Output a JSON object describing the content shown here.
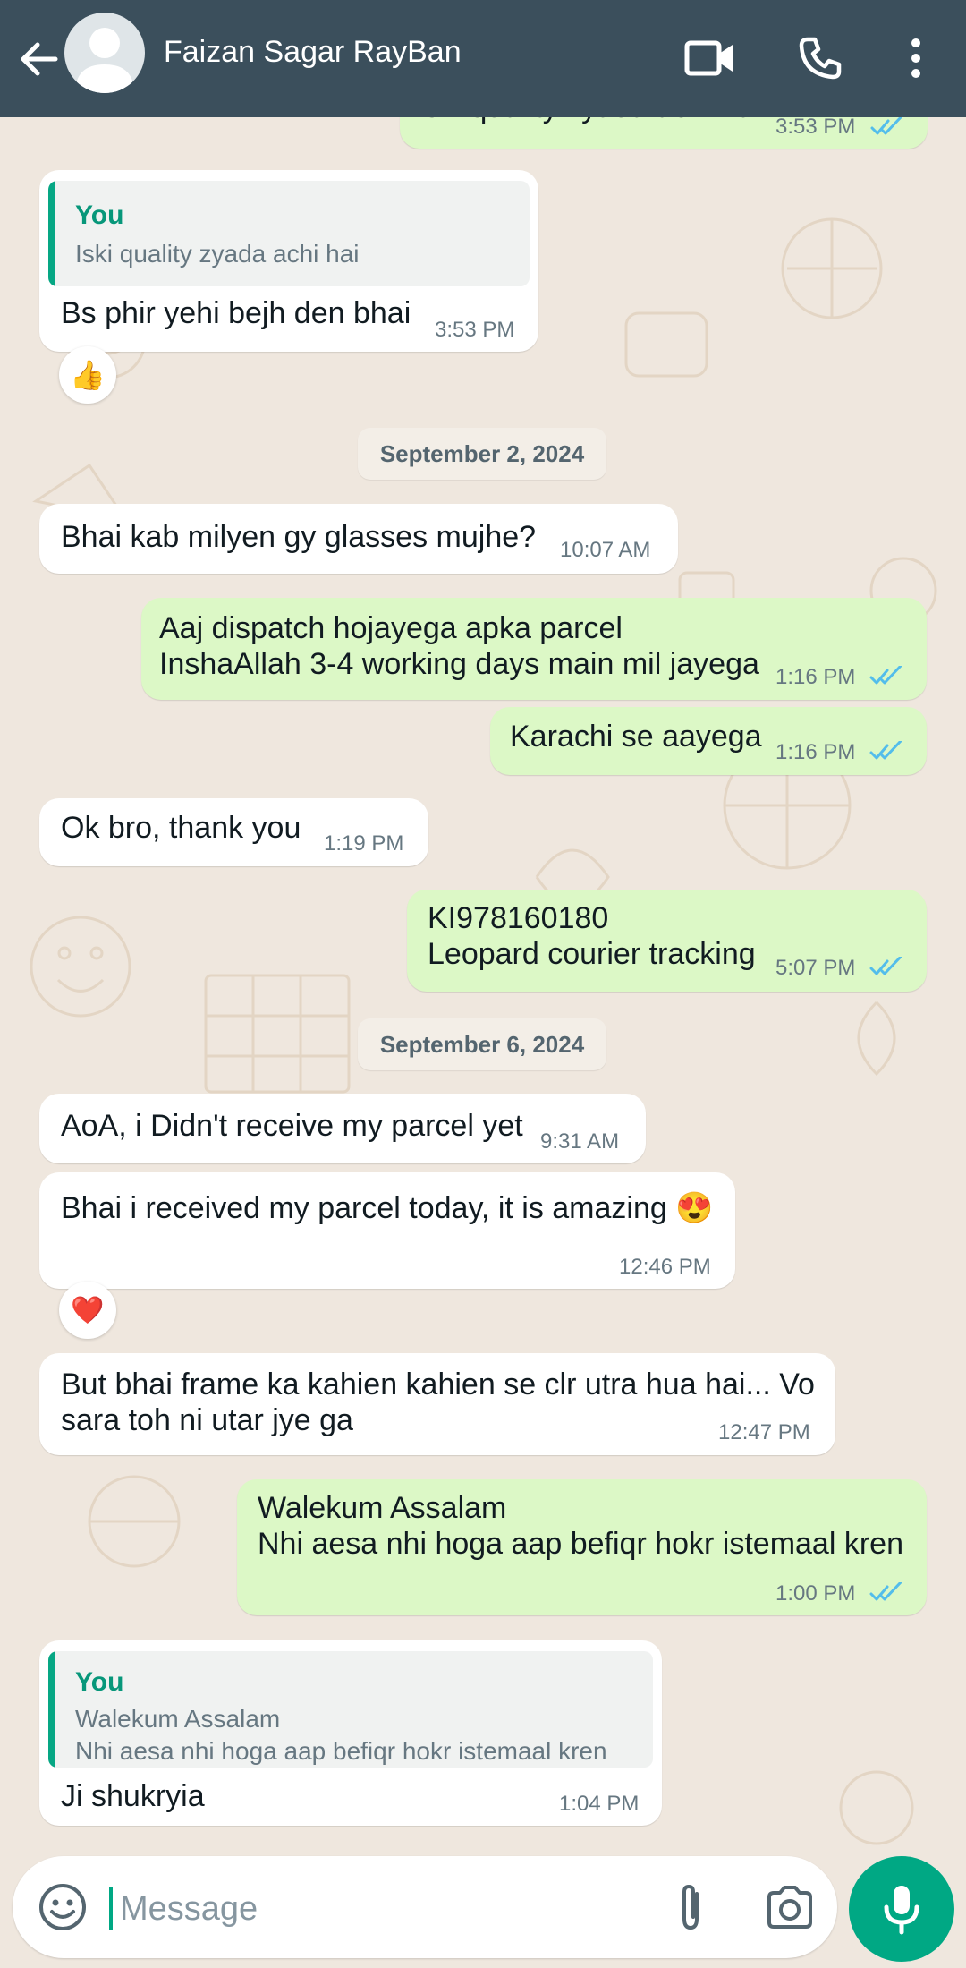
{
  "header": {
    "contact_name": "Faizan Sagar RayBan",
    "bg_color": "#3b4f5c",
    "icons": [
      "back-arrow-icon",
      "avatar",
      "video-call-icon",
      "voice-call-icon",
      "more-options-icon"
    ]
  },
  "messages": [
    {
      "dir": "out",
      "text": "Iski quality zyada achi hai",
      "time": "3:53 PM",
      "status": "read",
      "partial": true
    },
    {
      "dir": "in",
      "quote_author": "You",
      "quote_text": "Iski quality zyada achi hai",
      "text": "Bs phir yehi bejh den bhai",
      "time": "3:53 PM",
      "reaction": "👍"
    },
    {
      "dir": "in",
      "text": "Bhai kab milyen gy glasses mujhe?",
      "time": "10:07 AM"
    },
    {
      "dir": "out",
      "text": "Aaj dispatch hojayega apka parcel\nInshaAllah 3-4 working days main mil jayega",
      "time": "1:16 PM",
      "status": "read"
    },
    {
      "dir": "out",
      "text": "Karachi se aayega",
      "time": "1:16 PM",
      "status": "read"
    },
    {
      "dir": "in",
      "text": "Ok bro, thank you",
      "time": "1:19 PM"
    },
    {
      "dir": "out",
      "text": "KI978160180\nLeopard courier tracking",
      "time": "5:07 PM",
      "status": "read"
    },
    {
      "dir": "in",
      "text": "AoA, i Didn't receive my parcel yet",
      "time": "9:31 AM"
    },
    {
      "dir": "in",
      "text": "Bhai i received my parcel today, it is amazing 😍",
      "time": "12:46 PM",
      "reaction": "❤️"
    },
    {
      "dir": "in",
      "text": "But bhai frame ka kahien kahien se clr utra hua hai... Vo\nsara toh ni utar jye ga",
      "time": "12:47 PM"
    },
    {
      "dir": "out",
      "text": "Walekum Assalam\nNhi aesa nhi hoga aap befiqr hokr istemaal kren",
      "time": "1:00 PM",
      "status": "read"
    },
    {
      "dir": "in",
      "quote_author": "You",
      "quote_text": "Walekum Assalam\nNhi aesa nhi hoga aap befiqr hokr istemaal kren",
      "text": "Ji shukryia",
      "time": "1:04 PM"
    }
  ],
  "dates": [
    "September 2, 2024",
    "September 6, 2024"
  ],
  "composer": {
    "placeholder": "Message",
    "icons": [
      "emoji-icon",
      "attach-icon",
      "camera-icon",
      "mic-icon"
    ]
  },
  "colors": {
    "outgoing_bubble": "#dcf8c6",
    "incoming_bubble": "#ffffff",
    "read_tick": "#53bdeb",
    "accent": "#00a884",
    "wallpaper": "#efe7de"
  }
}
